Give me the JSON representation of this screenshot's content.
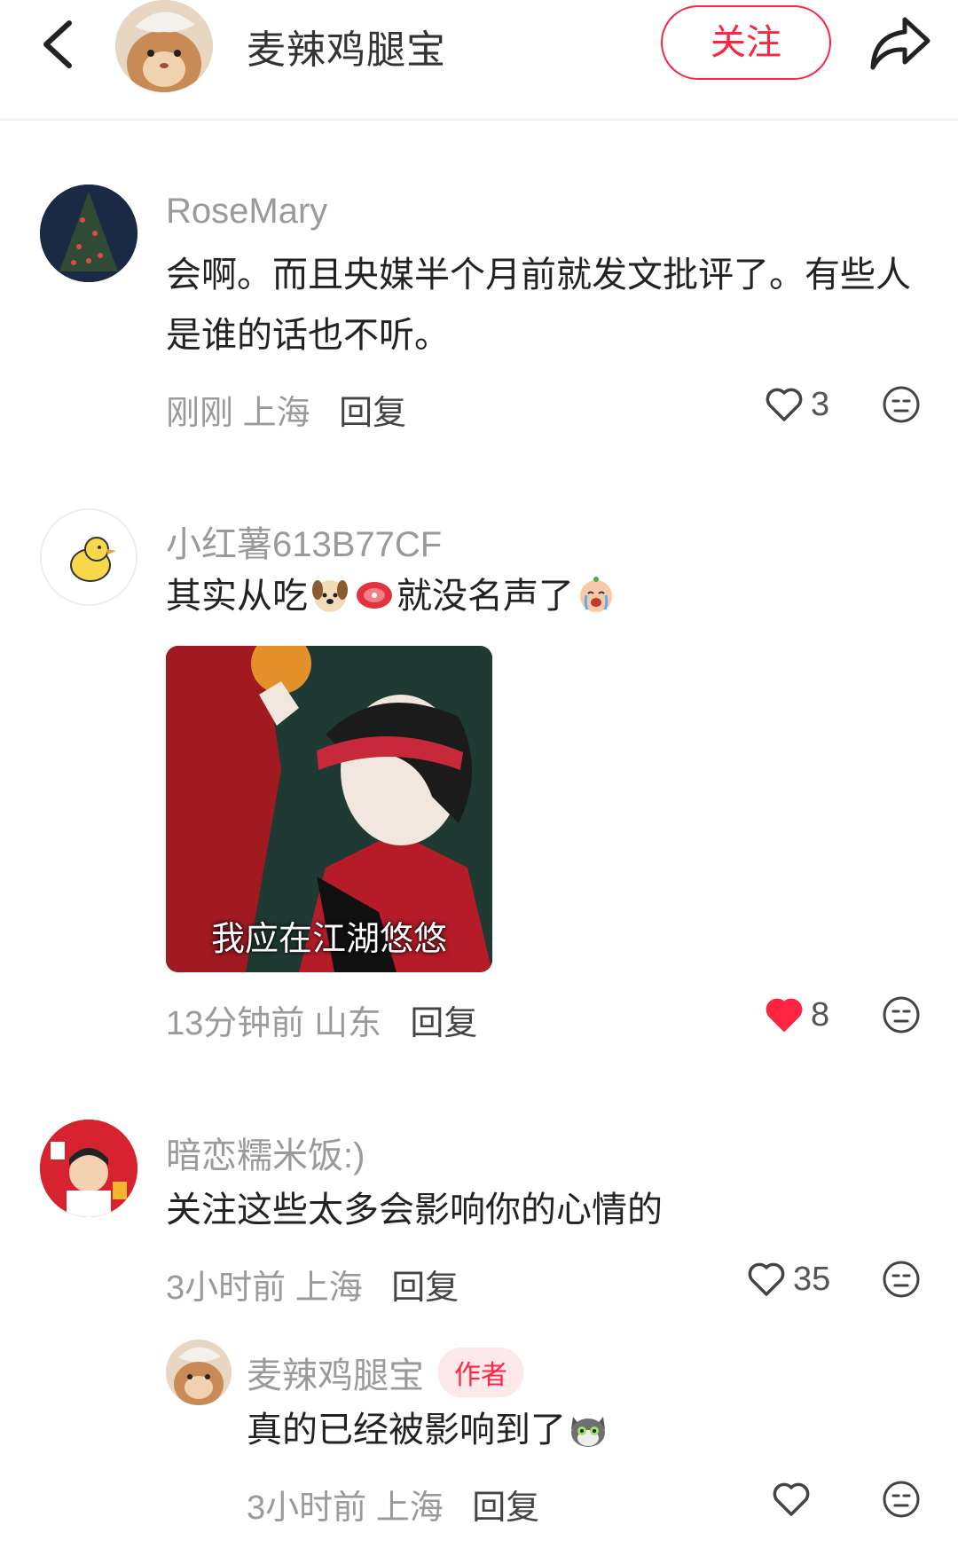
{
  "header": {
    "author_name": "麦辣鸡腿宝",
    "follow_label": "关注"
  },
  "comments": [
    {
      "username": "RoseMary",
      "text": "会啊。而且央媒半个月前就发文批评了。有些人是谁的话也不听。",
      "time": "刚刚",
      "location": "上海",
      "reply_label": "回复",
      "likes": "3",
      "liked": false
    },
    {
      "username": "小红薯613B77CF",
      "text": "其实从吃",
      "text_after_emojis": "就没名声了",
      "emojis": [
        "dog-emoji",
        "meat-emoji",
        "crying-face-emoji"
      ],
      "image_caption": "我应在江湖悠悠",
      "time": "13分钟前",
      "location": "山东",
      "reply_label": "回复",
      "likes": "8",
      "liked": true
    },
    {
      "username": "暗恋糯米饭:)",
      "text": "关注这些太多会影响你的心情的",
      "time": "3小时前",
      "location": "上海",
      "reply_label": "回复",
      "likes": "35",
      "liked": false
    }
  ],
  "reply": {
    "username": "麦辣鸡腿宝",
    "badge": "作者",
    "text": "真的已经被影响到了",
    "emoji": "cat-emoji",
    "time": "3小时前",
    "location": "上海",
    "reply_label": "回复"
  },
  "colors": {
    "accent": "#ff2442",
    "muted": "#9a9a9a"
  }
}
